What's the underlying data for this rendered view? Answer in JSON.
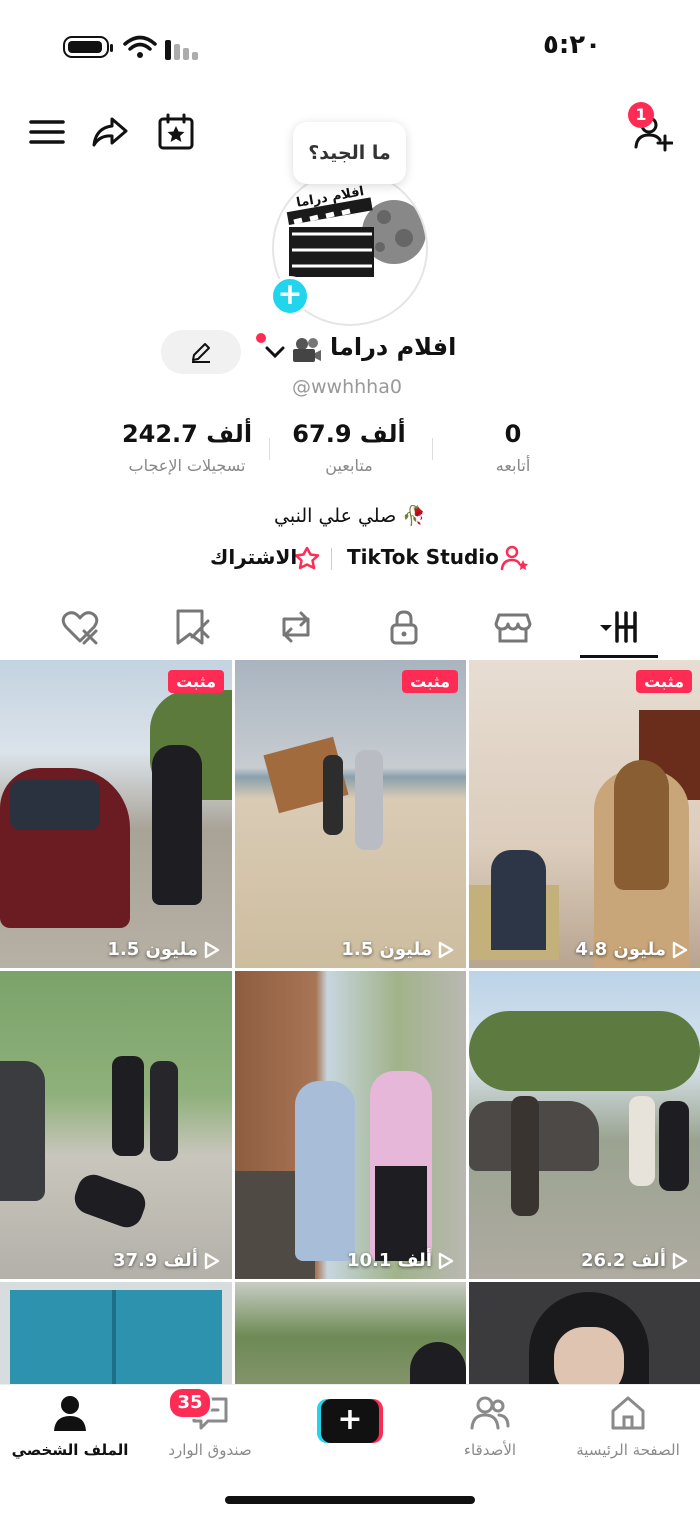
{
  "status_bar": {
    "time": "٥:٢٠"
  },
  "top_bar": {
    "friend_request_count": "1"
  },
  "avatar": {
    "bubble_text": "ما الجيد؟",
    "logo_text": "افلام دراما"
  },
  "profile": {
    "name": "افلام دراما",
    "handle": "@wwhhha0",
    "stats": [
      {
        "value": "242.7 ألف",
        "label": "تسجيلات الإعجاب"
      },
      {
        "value": "67.9 ألف",
        "label": "متابعين"
      },
      {
        "value": "0",
        "label": "أتابعه"
      }
    ],
    "bio": "صلي علي النبي 🥀",
    "links": {
      "subscription": "الاشتراك",
      "studio": "TikTok Studio"
    }
  },
  "pinned_label": "مثبت",
  "videos": [
    {
      "views": "4.8 مليون",
      "pinned": true
    },
    {
      "views": "1.5 مليون",
      "pinned": true
    },
    {
      "views": "1.5 مليون",
      "pinned": true
    },
    {
      "views": "26.2 ألف",
      "pinned": false
    },
    {
      "views": "10.1 ألف",
      "pinned": false
    },
    {
      "views": "37.9 ألف",
      "pinned": false
    },
    {
      "views": "",
      "pinned": false
    },
    {
      "views": "",
      "pinned": false
    },
    {
      "views": "",
      "pinned": false
    }
  ],
  "bottom_nav": {
    "home": "الصفحة الرئيسية",
    "friends": "الأصدقاء",
    "inbox": "صندوق الوارد",
    "inbox_count": "35",
    "profile": "الملف الشخصي"
  },
  "colors": {
    "accent": "#fe2c55",
    "cyan": "#20d5ec"
  },
  "icons": [
    "menu-icon",
    "share-icon",
    "calendar-star-icon",
    "add-friend-icon",
    "edit-icon",
    "videos-grid-icon",
    "shop-icon",
    "lock-icon",
    "repost-icon",
    "favorites-icon",
    "liked-icon",
    "home-icon",
    "friends-icon",
    "inbox-icon",
    "profile-icon"
  ]
}
